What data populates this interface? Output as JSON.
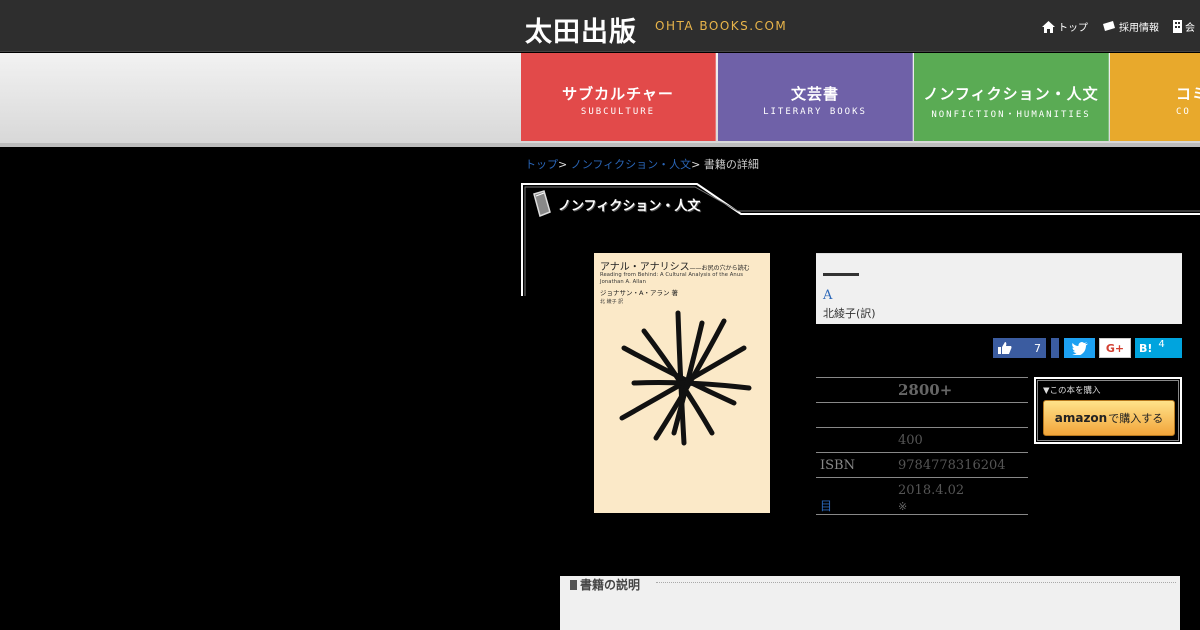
{
  "header": {
    "logo_text": "太田出版",
    "logo_sub": "OHTA BOOKS.COM",
    "links": [
      {
        "label": "トップ",
        "icon": "home-icon"
      },
      {
        "label": "採用情報",
        "icon": "ticket-icon"
      },
      {
        "label": "会",
        "icon": "building-icon"
      }
    ]
  },
  "nav": {
    "tabs": [
      {
        "jp": "サブカルチャー",
        "en": "SUBCULTURE",
        "color": "#e24a4a"
      },
      {
        "jp": "文芸書",
        "en": "LITERARY BOOKS",
        "color": "#6f61a8"
      },
      {
        "jp": "ノンフィクション・人文",
        "en": "NONFICTION・HUMANITIES",
        "color": "#5aab54"
      },
      {
        "jp": "コミ",
        "en": "CO",
        "color": "#e8a92c"
      }
    ]
  },
  "breadcrumb": {
    "home": "トップ",
    "category": "ノンフィクション・人文",
    "current": "書籍の詳細",
    "separator": ">"
  },
  "section": {
    "title": "ノンフィクション・人文"
  },
  "cover": {
    "title": "アナル・アナリシス",
    "subtitle": "——お尻の穴から読む",
    "en_title": "Reading from Behind: A Cultural Analysis of the Anus",
    "author_en": "Jonathan A. Allan",
    "author_jp": "ジョナサン・A・アラン 著",
    "translator": "北 綾子 訳"
  },
  "book": {
    "author": "A",
    "translator": "北綾子(訳)"
  },
  "social": {
    "like_count": "7",
    "gplus_label": "G+",
    "hatena_label": "B!",
    "hatena_count": "4"
  },
  "details": {
    "price": "2800+",
    "pages": "400",
    "isbn_label": "ISBN",
    "isbn": "9784778316204",
    "date": "2018.4.02",
    "date_note": "※",
    "link_label": "目"
  },
  "purchase": {
    "label": "▼この本を購入",
    "amazon_brand": "amazon",
    "button_text": "で購入する"
  },
  "description": {
    "title": "書籍の説明"
  }
}
